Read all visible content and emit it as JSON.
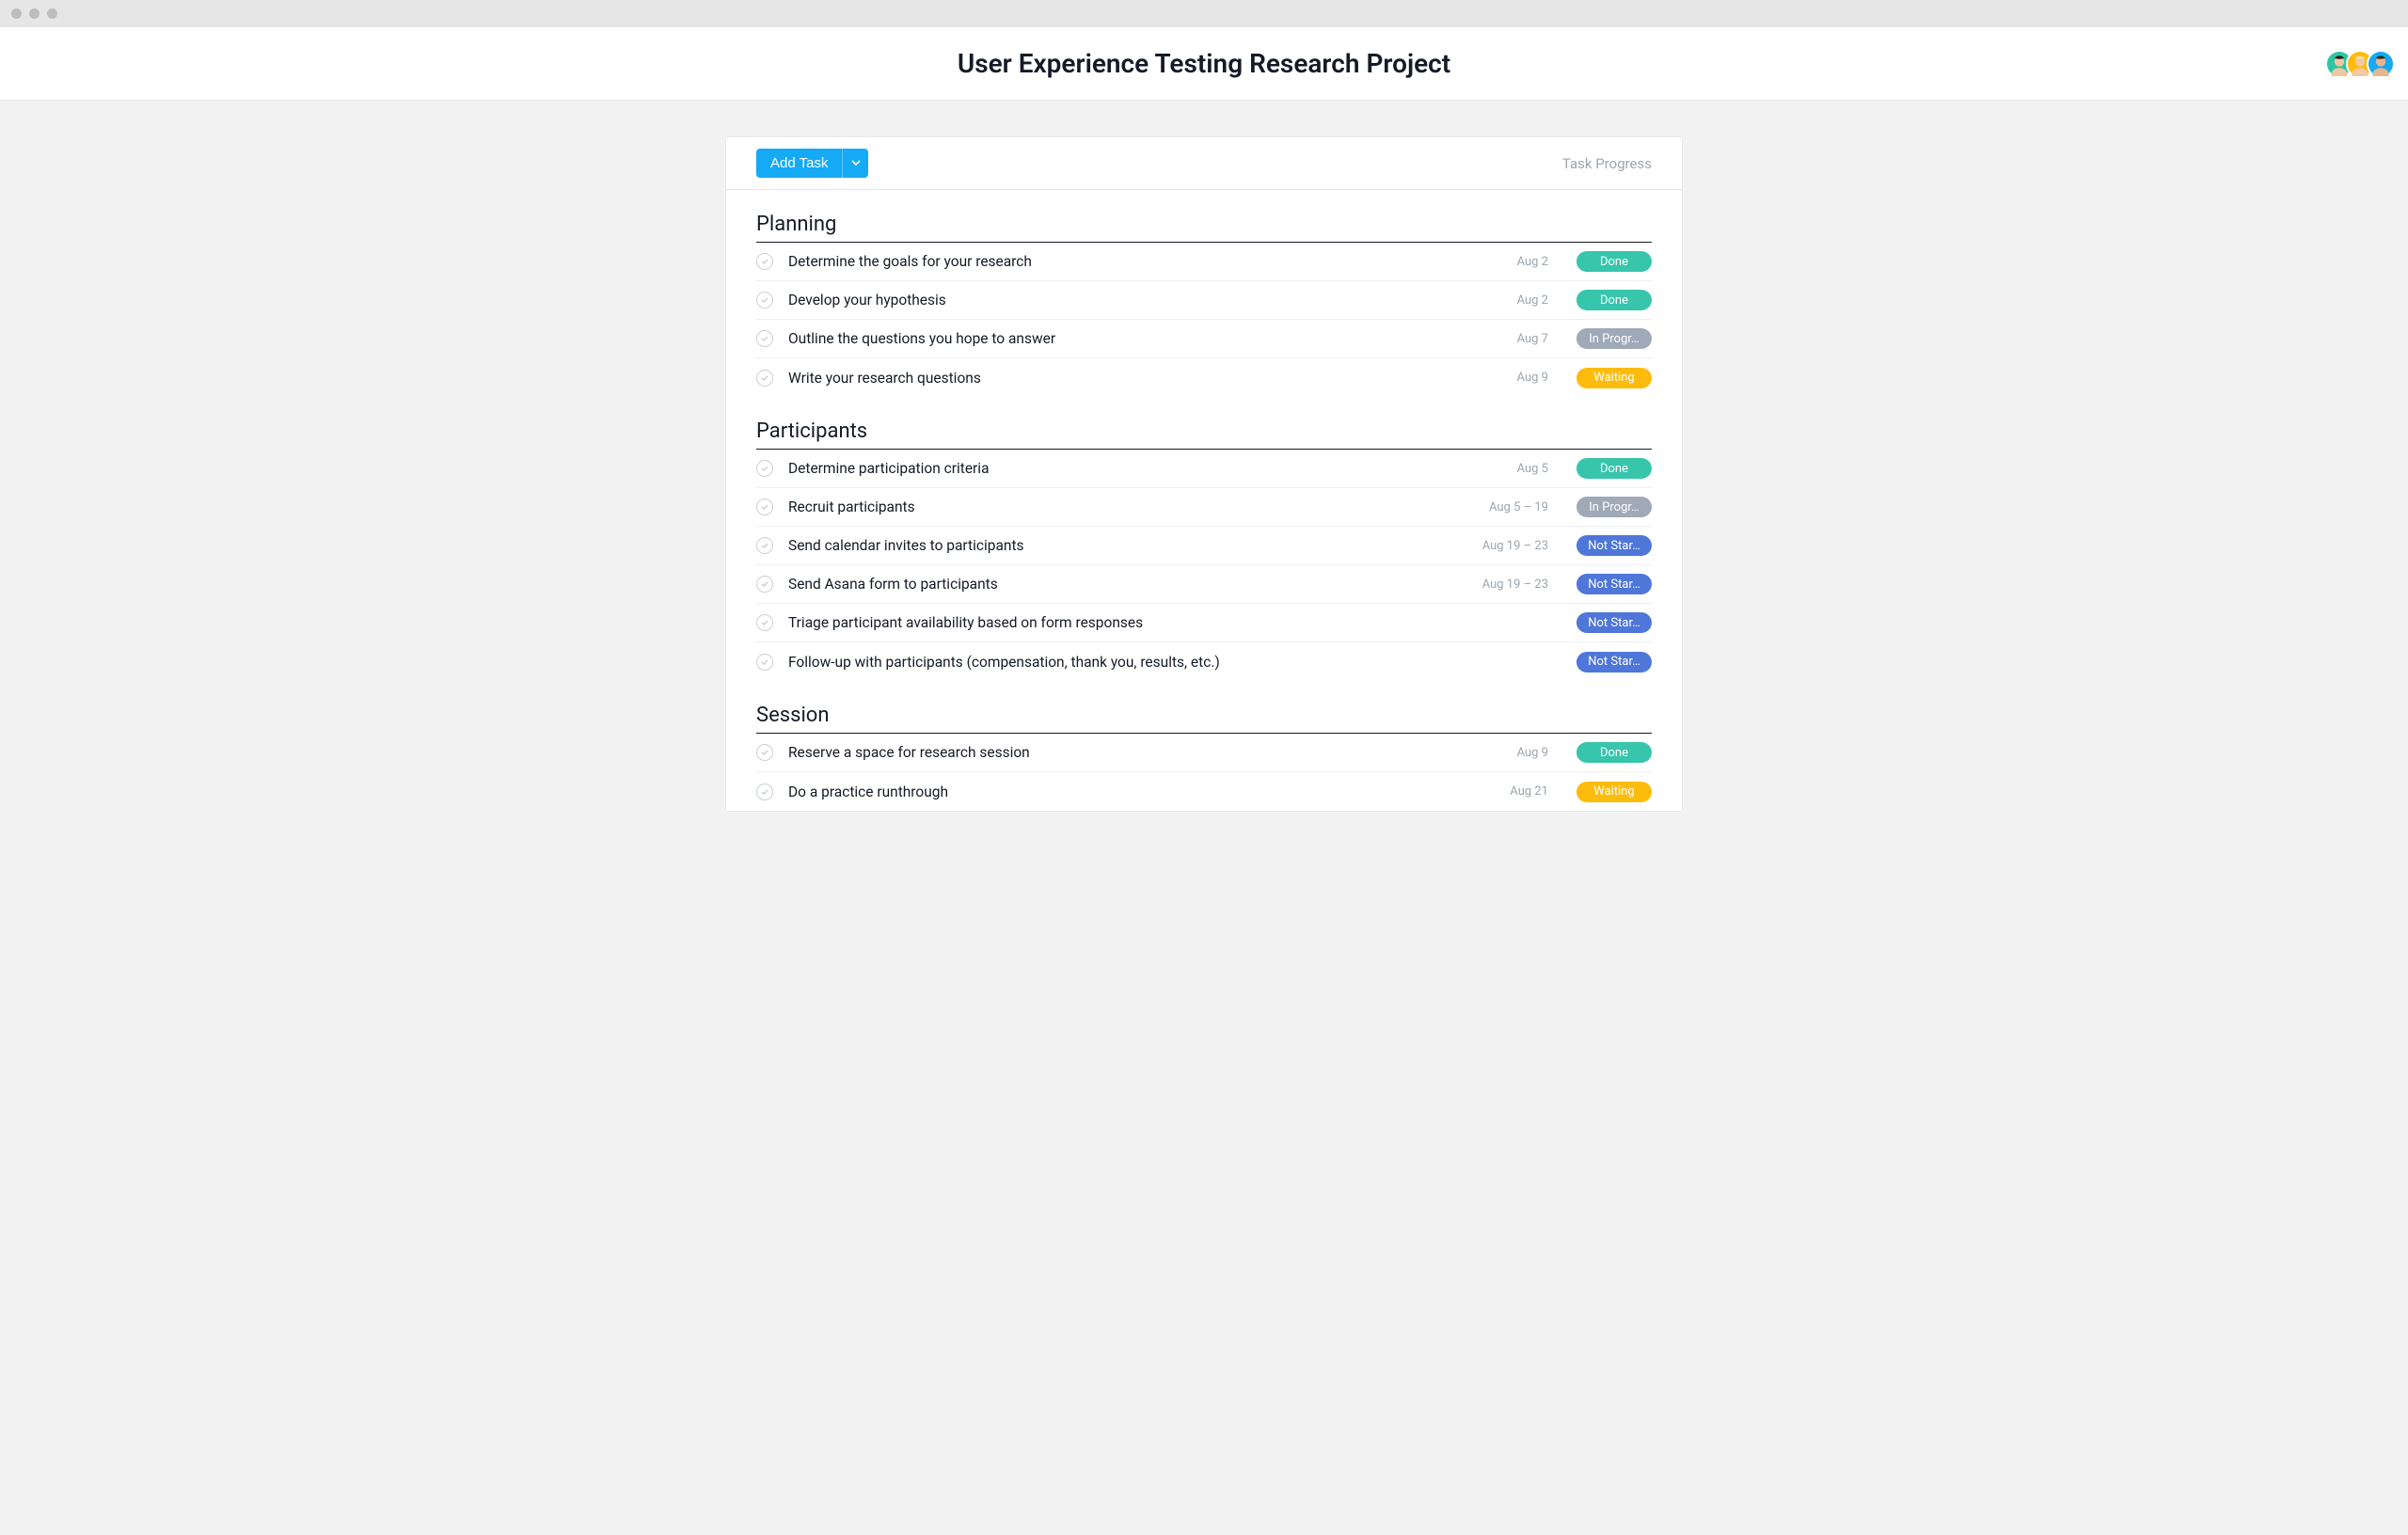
{
  "header": {
    "title": "User Experience Testing Research Project"
  },
  "toolbar": {
    "add_task_label": "Add Task",
    "progress_label": "Task Progress"
  },
  "statuses": {
    "done": "Done",
    "in_progress": "In Progr…",
    "waiting": "Waiting",
    "not_started": "Not Star…"
  },
  "sections": [
    {
      "title": "Planning",
      "tasks": [
        {
          "name": "Determine the goals for your research",
          "date": "Aug 2",
          "status": "done"
        },
        {
          "name": "Develop your hypothesis",
          "date": "Aug 2",
          "status": "done"
        },
        {
          "name": "Outline the questions you hope to answer",
          "date": "Aug 7",
          "status": "in_progress"
        },
        {
          "name": "Write your research questions",
          "date": "Aug 9",
          "status": "waiting"
        }
      ]
    },
    {
      "title": "Participants",
      "tasks": [
        {
          "name": "Determine participation criteria",
          "date": "Aug 5",
          "status": "done"
        },
        {
          "name": "Recruit participants",
          "date": "Aug 5 – 19",
          "status": "in_progress"
        },
        {
          "name": "Send calendar invites to participants",
          "date": "Aug 19 – 23",
          "status": "not_started"
        },
        {
          "name": "Send Asana form to participants",
          "date": "Aug 19 – 23",
          "status": "not_started"
        },
        {
          "name": "Triage participant availability based on form responses",
          "date": "",
          "status": "not_started"
        },
        {
          "name": "Follow-up with participants (compensation, thank you, results, etc.)",
          "date": "",
          "status": "not_started"
        }
      ]
    },
    {
      "title": "Session",
      "tasks": [
        {
          "name": "Reserve a space for research session",
          "date": "Aug 9",
          "status": "done"
        },
        {
          "name": "Do a practice runthrough",
          "date": "Aug 21",
          "status": "waiting"
        }
      ]
    }
  ],
  "avatars": [
    {
      "bg": "#2cc6a4",
      "hair": "#2a1a14",
      "skin": "#f0c7a0"
    },
    {
      "bg": "#fdbc0b",
      "hair": "#f3e0a8",
      "skin": "#f2c8a5"
    },
    {
      "bg": "#14aaf5",
      "hair": "#3a2a1e",
      "skin": "#e6b68e"
    }
  ],
  "colors": {
    "primary_blue": "#14aaf5",
    "done": "#37c5ab",
    "in_progress": "#9fa9b8",
    "waiting": "#fdbc0b",
    "not_started": "#4f76d9"
  }
}
